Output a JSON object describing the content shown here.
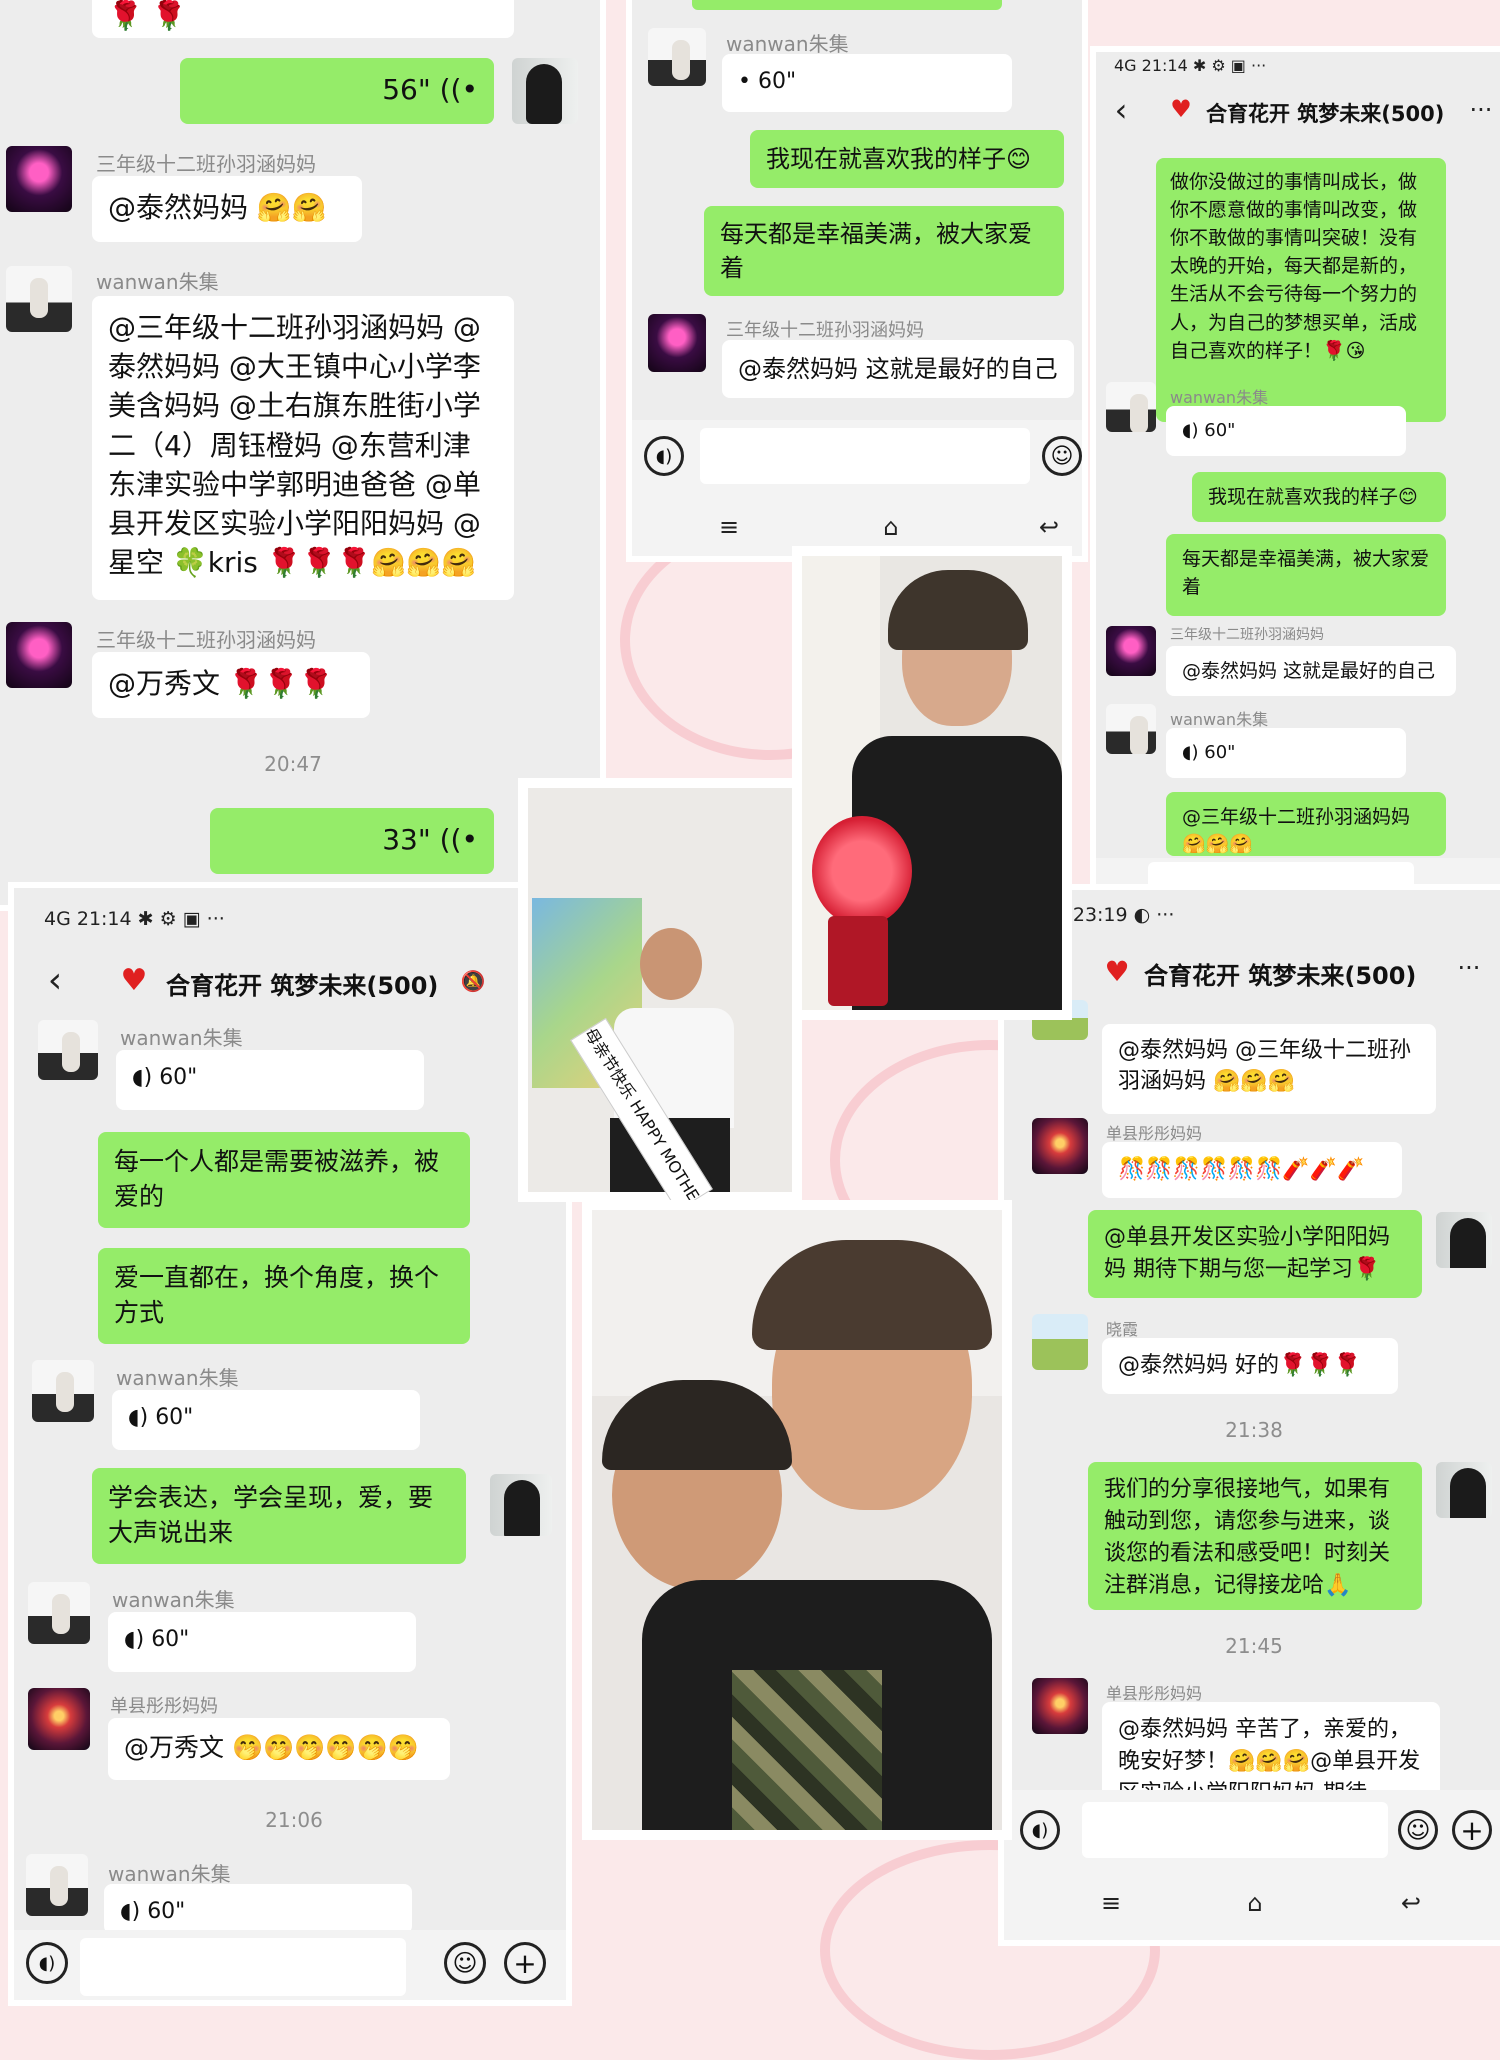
{
  "colors": {
    "accent_green": "#95ec69",
    "chat_bg": "#ededed",
    "page_bg": "#fbe9ea"
  },
  "group": {
    "title": "合育花开 筑梦未来(500)"
  },
  "status": {
    "a": "4G  21:14  ✱ ⚙ ▣ ···",
    "b": "4G  23:19  ◐ ···",
    "c": "4G  21:14  ✱ ⚙ ▣ ···"
  },
  "names": {
    "w": "wanwan朱集",
    "n": "三年级十二班孙羽涵妈妈",
    "f": "单县彤彤妈妈",
    "s": "晓霞"
  },
  "voice": {
    "v60": "60\"",
    "v56": "56\"",
    "v33": "33\""
  },
  "times": {
    "t2047": "20:47",
    "t2106": "21:06",
    "t2138": "21:38",
    "t2145": "21:45"
  },
  "p1": {
    "m_tairan": "@泰然妈妈 🤗🤗",
    "m_long": "@三年级十二班孙羽涵妈妈 @泰然妈妈 @大王镇中心小学李美含妈妈 @土右旗东胜街小学二（4）周钰橙妈 @东营利津东津实验中学郭明迪爸爸 @单县开发区实验小学阳阳妈妈 @星空 🍀kris 🌹🌹🌹🤗🤗🤗",
    "m_wan": "@万秀文 🌹🌹🌹",
    "top_roses": "🌹 🌹"
  },
  "p2": {
    "m1": "我现在就喜欢我的样子😊",
    "m2": "每天都是幸福美满，被大家爱着",
    "m3": "@泰然妈妈  这就是最好的自己"
  },
  "p3": {
    "m1": "做你没做过的事情叫成长，做你不愿意做的事情叫改变，做你不敢做的事情叫突破！没有太晚的开始，每天都是新的，生活从不会亏待每一个努力的人，为自己的梦想买单，活成自己喜欢的样子！🌹😘",
    "m2": "我现在就喜欢我的样子😊",
    "m3": "每天都是幸福美满，被大家爱着",
    "m4": "@泰然妈妈  这就是最好的自己",
    "m5": "@三年级十二班孙羽涵妈妈 🤗🤗🤗"
  },
  "p4": {
    "m1": "每一个人都是需要被滋养，被爱的",
    "m2": "爱一直都在，换个角度，换个方式",
    "m3": "学会表达，学会呈现，爱，要大声说出来",
    "m4": "@万秀文 🤭🤭🤭🤭🤭🤭"
  },
  "p5": {
    "m1": "@泰然妈妈 @三年级十二班孙羽涵妈妈 🤗🤗🤗",
    "m2": "🎊🎊🎊🎊🎊🎊🧨🧨🧨",
    "m3": "@单县开发区实验小学阳阳妈妈  期待下期与您一起学习🌹",
    "m4": "@泰然妈妈  好的🌹🌹🌹",
    "m5": "我们的分享很接地气，如果有触动到您，请您参与进来，谈谈您的看法和感受吧！时刻关注群消息，记得接龙哈🙏",
    "m6": "@泰然妈妈  辛苦了，亲爱的，晚安好梦！🤗🤗🤗@单县开发区实验小学阳阳妈妈  期待"
  },
  "sash": "母亲节快乐 HAPPY MOTHER'S DAY",
  "icons": [
    "voice-icon",
    "emoji-icon",
    "plus-icon",
    "back-icon",
    "more-icon",
    "heart-icon",
    "mute-bell-icon",
    "menu-icon",
    "home-icon",
    "return-icon"
  ]
}
